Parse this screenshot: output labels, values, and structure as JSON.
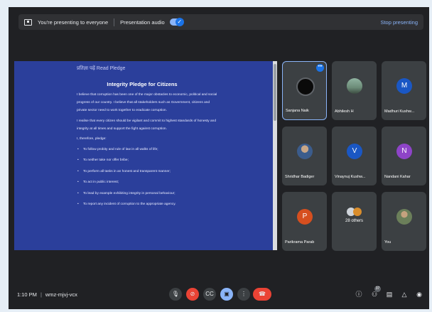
{
  "present_bar": {
    "status_text": "You're presenting to everyone",
    "audio_label": "Presentation audio",
    "stop_label": "Stop presenting"
  },
  "slide": {
    "header": "प्रतिज्ञा पढ़ें Read Pledge",
    "title": "Integrity Pledge for Citizens",
    "paragraphs": [
      "I believe that corruption has been one of the major obstacles to economic, political and social progress of our country. I believe that all stakeholders such as Government, citizens and private sector need to work together to eradicate corruption.",
      "I realise that every citizen should be vigilant and commit to highest standards of honesty and integrity at all times and support the fight against corruption.",
      "I, therefore, pledge:"
    ],
    "bullets": [
      "To follow probity and rule of law in all walks of life;",
      "To neither take nor offer bribe;",
      "To perform all tasks in an honest and transparent manner;",
      "To act in public interest;",
      "To lead by example exhibiting integrity in personal behaviour;",
      "To report any incident of corruption to the appropriate agency."
    ]
  },
  "participants": [
    {
      "name": "Sanjana Naik",
      "initial": "",
      "avatar": "photo-dark",
      "icon": "user-photo-icon"
    },
    {
      "name": "Abhilesh H",
      "initial": "",
      "avatar": "photo-green",
      "icon": "user-photo-icon"
    },
    {
      "name": "Madhuri Kushw...",
      "initial": "M",
      "avatar": "blue",
      "icon": "user-avatar-icon"
    },
    {
      "name": "Shridhar Badiger",
      "initial": "",
      "avatar": "photo-person",
      "icon": "user-photo-icon"
    },
    {
      "name": "Vinaynuj Kushw...",
      "initial": "V",
      "avatar": "blue",
      "icon": "user-avatar-icon"
    },
    {
      "name": "Nandani Kahar",
      "initial": "N",
      "avatar": "purple",
      "icon": "user-avatar-icon"
    },
    {
      "name": "Parikrama Parab",
      "initial": "P",
      "avatar": "orange",
      "icon": "user-avatar-icon"
    },
    {
      "name": "You",
      "initial": "",
      "avatar": "photo-man",
      "icon": "user-photo-icon"
    }
  ],
  "others_tile": {
    "label": "28 others"
  },
  "bottom_bar": {
    "time": "1:10 PM",
    "meeting_code": "wmz-mjvj-vcx",
    "people_count": "37"
  },
  "icons": {
    "mic": "mic-icon",
    "camera_off": "camera-off-icon",
    "captions": "captions-icon",
    "present": "present-screen-icon",
    "more": "more-options-icon",
    "hangup": "hangup-icon",
    "info": "info-icon",
    "people": "people-icon",
    "chat": "chat-icon",
    "activities": "activities-icon",
    "host_controls": "host-controls-icon"
  },
  "colors": {
    "accent": "#8ab4f8",
    "danger": "#ea4335",
    "background": "#202124"
  }
}
